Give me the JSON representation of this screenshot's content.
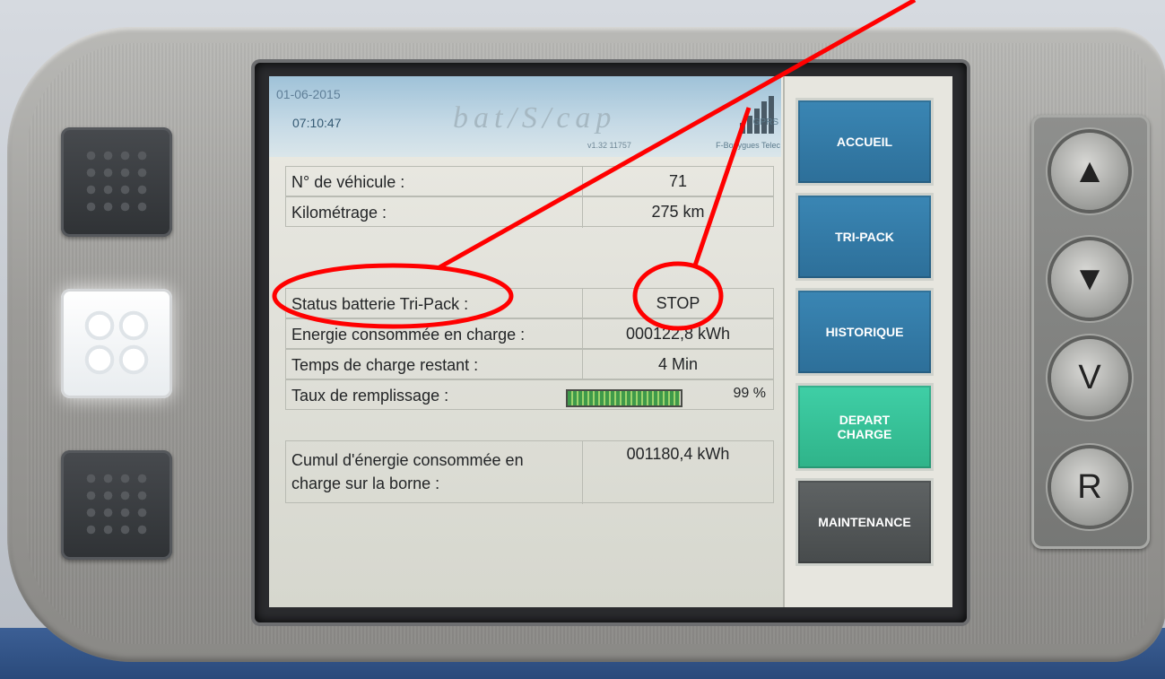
{
  "header": {
    "date": "01-06-2015",
    "time": "07:10:47",
    "logo_text": "bat/S/cap",
    "version": "v1.32 11757",
    "network": "GPRS",
    "operator": "F-Bouygues Telec"
  },
  "rows": {
    "vehicle": {
      "label": "N° de véhicule :",
      "value": "71"
    },
    "mileage": {
      "label": "Kilométrage :",
      "value": "275 km"
    },
    "battery_status": {
      "label": "Status batterie Tri-Pack :",
      "value": "STOP"
    },
    "energy_consumed": {
      "label": "Energie consommée en charge :",
      "value": "000122,8 kWh"
    },
    "time_remaining": {
      "label": "Temps de charge restant :",
      "value": "4 Min"
    },
    "fill_rate": {
      "label": "Taux de remplissage :",
      "value": "99 %",
      "fraction": 0.99
    },
    "cumulative": {
      "label_line1": "Cumul d'énergie consommée en",
      "label_line2": "charge sur la borne :",
      "value": "001180,4 kWh"
    }
  },
  "menu": {
    "home": "ACCUEIL",
    "tripack": "TRI-PACK",
    "history": "HISTORIQUE",
    "depart_line1": "DEPART",
    "depart_line2": "CHARGE",
    "maintenance": "MAINTENANCE"
  },
  "keypad": {
    "up_icon": "▲",
    "down_icon": "▼",
    "validate": "V",
    "reset": "R"
  },
  "colors": {
    "menu_blue": "#3a86b4",
    "menu_green": "#3fcfa6",
    "menu_grey": "#555a5b",
    "annotation_red": "#ff0000"
  }
}
